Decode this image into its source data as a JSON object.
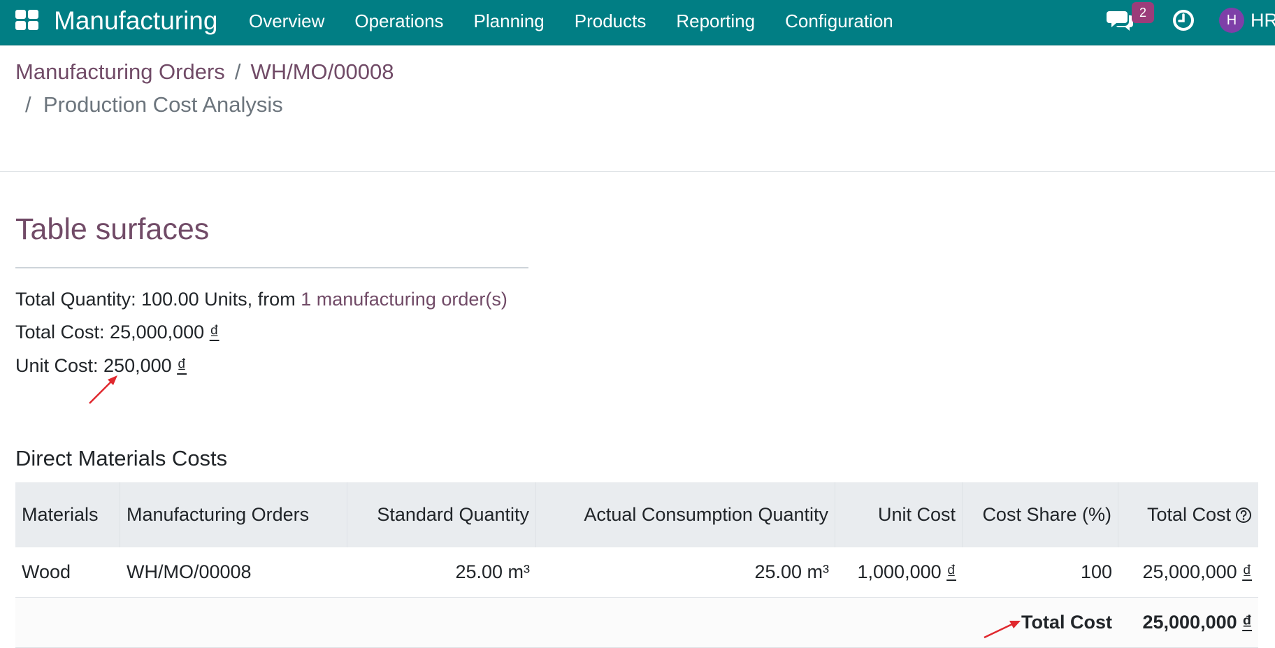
{
  "navbar": {
    "app_name": "Manufacturing",
    "menu": [
      "Overview",
      "Operations",
      "Planning",
      "Products",
      "Reporting",
      "Configuration"
    ],
    "chat_badge": "2",
    "avatar_initial": "H",
    "user_name": "HR",
    "bg_color": "#017e84"
  },
  "breadcrumb": {
    "root": "Manufacturing Orders",
    "order": "WH/MO/00008",
    "separator": "/",
    "current": "Production Cost Analysis"
  },
  "report": {
    "title": "Table surfaces",
    "total_quantity_label": "Total Quantity: 100.00 Units, from",
    "orders_link": "1 manufacturing order(s)",
    "total_cost_label": "Total Cost: 25,000,000",
    "unit_cost_label": "Unit Cost: 250,000",
    "currency": "₫"
  },
  "direct_materials": {
    "section_title": "Direct Materials Costs",
    "columns": [
      "Materials",
      "Manufacturing Orders",
      "Standard Quantity",
      "Actual Consumption Quantity",
      "Unit Cost",
      "Cost Share (%)",
      "Total Cost"
    ],
    "rows": [
      {
        "material": "Wood",
        "order": "WH/MO/00008",
        "standard_qty": "25.00 m³",
        "actual_qty": "25.00 m³",
        "unit_cost": "1,000,000",
        "cost_share": "100",
        "total_cost": "25,000,000"
      }
    ],
    "footer": {
      "label": "Total Cost",
      "value": "25,000,000"
    }
  },
  "colors": {
    "accent": "#714b67",
    "annotation_arrow": "#e0282e"
  }
}
